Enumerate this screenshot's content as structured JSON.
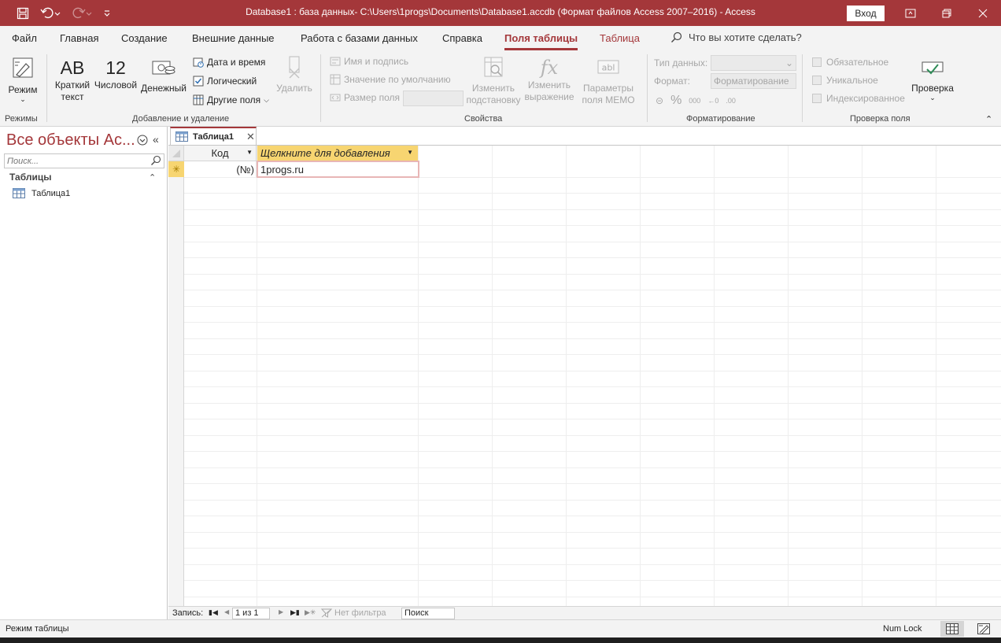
{
  "titlebar": {
    "title": "Database1 : база данных- C:\\Users\\1progs\\Documents\\Database1.accdb (Формат файлов Access 2007–2016)  -  Access",
    "signin_label": "Вход",
    "undo_icon": "undo-icon",
    "redo_icon": "redo-icon",
    "colors": {
      "accent": "#a4373a"
    }
  },
  "tabs": [
    {
      "label": "Файл"
    },
    {
      "label": "Главная"
    },
    {
      "label": "Создание"
    },
    {
      "label": "Внешние данные"
    },
    {
      "label": "Работа с базами данных"
    },
    {
      "label": "Справка"
    },
    {
      "label": "Поля таблицы"
    },
    {
      "label": "Таблица"
    }
  ],
  "tell_me": "Что вы хотите сделать?",
  "ribbon": {
    "views": {
      "mode_label": "Режим",
      "group_label": "Режимы"
    },
    "add_delete": {
      "short_text_glyph": "AB",
      "short_text_label_1": "Краткий",
      "short_text_label_2": "текст",
      "number_glyph": "12",
      "number_label": "Числовой",
      "currency_label": "Денежный",
      "date_time_label": "Дата и время",
      "yes_no_label": "Логический",
      "more_fields_label": "Другие поля",
      "delete_label": "Удалить",
      "group_label": "Добавление и удаление"
    },
    "properties": {
      "name_caption_label": "Имя и подпись",
      "default_value_label": "Значение по умолчанию",
      "field_size_label": "Размер поля",
      "modify_lookups_1": "Изменить",
      "modify_lookups_2": "подстановку",
      "modify_expression_1": "Изменить",
      "modify_expression_2": "выражение",
      "memo_settings_1": "Параметры",
      "memo_settings_2": "поля MEMO",
      "group_label": "Свойства"
    },
    "formatting": {
      "data_type_label": "Тип данных:",
      "format_label": "Формат:",
      "format_value": "Форматирование",
      "group_label": "Форматирование"
    },
    "validation": {
      "required_label": "Обязательное",
      "unique_label": "Уникальное",
      "indexed_label": "Индексированное",
      "validation_label": "Проверка",
      "group_label": "Проверка поля"
    }
  },
  "navpane": {
    "title": "Все объекты Ac...",
    "search_placeholder": "Поиск...",
    "group_label": "Таблицы",
    "items": [
      {
        "label": "Таблица1"
      }
    ]
  },
  "document": {
    "tab_label": "Таблица1",
    "columns": [
      {
        "label": "Код"
      },
      {
        "label": "Щелкните для добавления"
      }
    ],
    "new_row": {
      "kod": "(№)",
      "value": "1progs.ru"
    }
  },
  "recnav": {
    "record_label": "Запись:",
    "position": "1 из 1",
    "filter_label": "Нет фильтра",
    "search_label": "Поиск"
  },
  "statusbar": {
    "mode": "Режим таблицы",
    "numlock": "Num Lock"
  }
}
